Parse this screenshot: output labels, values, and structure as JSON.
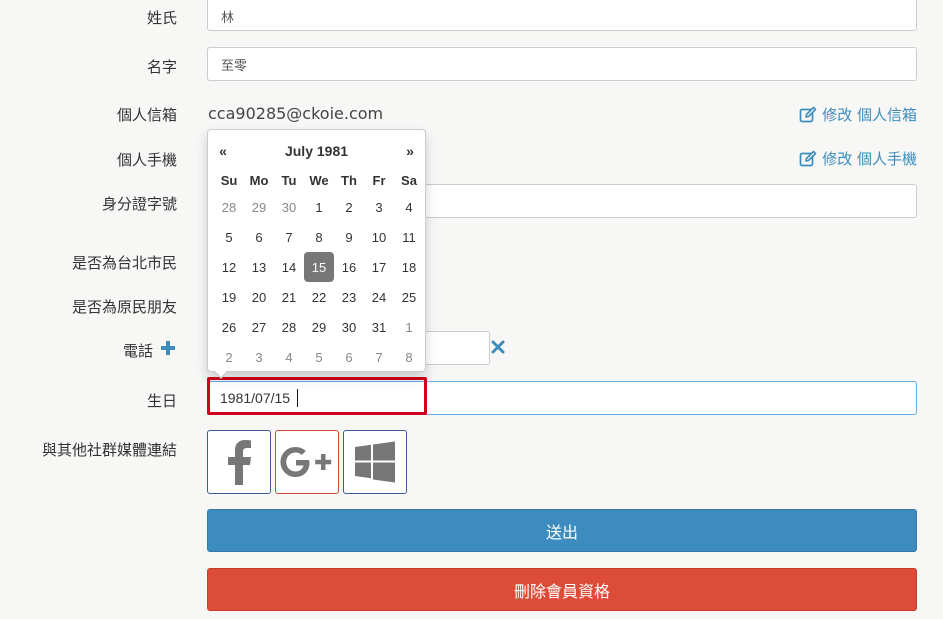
{
  "fields": {
    "last_name": {
      "label": "姓氏",
      "value": "林"
    },
    "first_name": {
      "label": "名字",
      "value": "至零"
    },
    "email": {
      "label": "個人信箱",
      "value": "cca90285@ckoie.com",
      "edit_label": "修改 個人信箱"
    },
    "phone_mobile": {
      "label": "個人手機",
      "edit_label": "修改 個人手機"
    },
    "id_number": {
      "label": "身分證字號"
    },
    "taipei_resident": {
      "label": "是否為台北市民"
    },
    "aboriginal": {
      "label": "是否為原民朋友"
    },
    "telephone": {
      "label": "電話"
    },
    "birthday": {
      "label": "生日",
      "value": "1981/07/15"
    },
    "social": {
      "label": "與其他社群媒體連結",
      "items": [
        "facebook-icon",
        "google-plus-icon",
        "windows-icon"
      ]
    }
  },
  "buttons": {
    "submit": "送出",
    "delete": "刪除會員資格"
  },
  "datepicker": {
    "prev": "«",
    "next": "»",
    "title": "July 1981",
    "weekdays": [
      "Su",
      "Mo",
      "Tu",
      "We",
      "Th",
      "Fr",
      "Sa"
    ],
    "days": [
      {
        "d": "28",
        "old": true
      },
      {
        "d": "29",
        "old": true
      },
      {
        "d": "30",
        "old": true
      },
      {
        "d": "1"
      },
      {
        "d": "2"
      },
      {
        "d": "3"
      },
      {
        "d": "4"
      },
      {
        "d": "5"
      },
      {
        "d": "6"
      },
      {
        "d": "7"
      },
      {
        "d": "8"
      },
      {
        "d": "9"
      },
      {
        "d": "10"
      },
      {
        "d": "11"
      },
      {
        "d": "12"
      },
      {
        "d": "13"
      },
      {
        "d": "14"
      },
      {
        "d": "15",
        "active": true
      },
      {
        "d": "16"
      },
      {
        "d": "17"
      },
      {
        "d": "18"
      },
      {
        "d": "19"
      },
      {
        "d": "20"
      },
      {
        "d": "21"
      },
      {
        "d": "22"
      },
      {
        "d": "23"
      },
      {
        "d": "24"
      },
      {
        "d": "25"
      },
      {
        "d": "26"
      },
      {
        "d": "27"
      },
      {
        "d": "28"
      },
      {
        "d": "29"
      },
      {
        "d": "30"
      },
      {
        "d": "31"
      },
      {
        "d": "1",
        "old": true
      },
      {
        "d": "2",
        "old": true
      },
      {
        "d": "3",
        "old": true
      },
      {
        "d": "4",
        "old": true
      },
      {
        "d": "5",
        "old": true
      },
      {
        "d": "6",
        "old": true
      },
      {
        "d": "7",
        "old": true
      },
      {
        "d": "8",
        "old": true
      }
    ]
  },
  "colors": {
    "link": "#3c8dbc",
    "submit": "#3d8cbf",
    "delete": "#dd4b39",
    "highlight": "#d0021b"
  }
}
